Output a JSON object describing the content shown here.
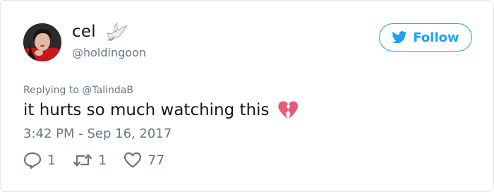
{
  "user": {
    "display_name": "cel",
    "handle": "@holdingoon",
    "name_emoji": "dove-icon"
  },
  "follow_button": {
    "label": "Follow",
    "icon": "twitter-bird-icon",
    "accent": "#1da1f2"
  },
  "tweet": {
    "reply_prefix": "Replying to",
    "reply_to": "@TalindaB",
    "text": "it hurts so much watching this",
    "emoji": "broken-heart-icon",
    "timestamp": "3:42 PM - Sep 16, 2017"
  },
  "actions": {
    "replies": "1",
    "retweets": "1",
    "likes": "77"
  },
  "colors": {
    "text": "#14171a",
    "secondary": "#657786",
    "border": "#e1e8ed",
    "broken_heart": "#e8597a"
  }
}
